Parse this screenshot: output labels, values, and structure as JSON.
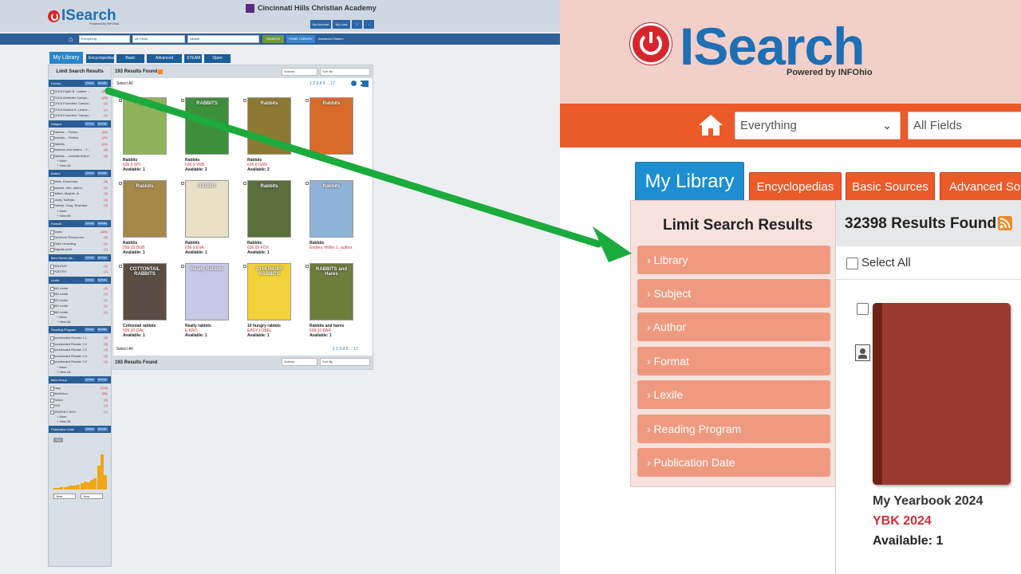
{
  "left": {
    "logo_text": "ISearch",
    "powered": "Powered by INFOhio",
    "school": "Cincinnati Hills Christian Academy",
    "header_buttons": [
      "My Account",
      "My Lists"
    ],
    "search": {
      "scope": "Everything",
      "field": "All Fields",
      "query": "rabbits",
      "search_btn": "SEARCH",
      "home_btn": "HOME LIBRARY",
      "advanced": "Advanced Search"
    },
    "tabs": [
      "My Library",
      "Encyclopedias",
      "Basic Sources",
      "Advanced Sources",
      "STEAM",
      "Open Access"
    ],
    "sidebar_title": "Limit Search Results",
    "facet_buttons": [
      "Include",
      "Exclude"
    ],
    "more": "+ More",
    "view_all": "+ View All",
    "facets": [
      {
        "title": "Library",
        "rows": [
          {
            "label": "CHCA Edyth B. Lindner ...",
            "count": "(93)"
          },
          {
            "label": "CHCA Armleder Campu...",
            "count": "(28)"
          },
          {
            "label": "CHCA Founders' Campu...",
            "count": "(1)"
          },
          {
            "label": "CHCA Martha S. Lindne...",
            "count": "(1)"
          },
          {
            "label": "CHCA Founders' Campu...",
            "count": "(1)"
          }
        ],
        "more": false
      },
      {
        "title": "Subject",
        "rows": [
          {
            "label": "Rabbits -- Fiction.",
            "count": "(44)"
          },
          {
            "label": "Animals -- Fiction.",
            "count": "(21)"
          },
          {
            "label": "Rabbits.",
            "count": "(21)"
          },
          {
            "label": "Brothers and sisters -- F...",
            "count": "(8)"
          },
          {
            "label": "Rabbits -- Juvenile fiction",
            "count": "(8)"
          }
        ],
        "more": true
      },
      {
        "title": "Author",
        "rows": [
          {
            "label": "Wells, Rosemary.",
            "count": "(8)"
          },
          {
            "label": "Bassett, Kim, author.",
            "count": "(5)"
          },
          {
            "label": "Holbet, Mayble, ill.",
            "count": "(3)"
          },
          {
            "label": "Lacey, Kathryn.",
            "count": "(3)"
          },
          {
            "label": "Potoski, Greg, illustrator.",
            "count": "(3)"
          }
        ],
        "more": true
      },
      {
        "title": "Format",
        "rows": [
          {
            "label": "Books",
            "count": "(185)"
          },
          {
            "label": "Electronic Resources",
            "count": "(5)"
          },
          {
            "label": "Video recording",
            "count": "(2)"
          },
          {
            "label": "Regular print",
            "count": "(1)"
          }
        ],
        "more": false
      },
      {
        "title": "Item Genre (Ite...",
        "rows": [
          {
            "label": "HOLIDAY",
            "count": "(1)"
          },
          {
            "label": "POETRY",
            "count": "(1)"
          }
        ],
        "more": false
      },
      {
        "title": "Lexile",
        "rows": [
          {
            "label": "340 Lexile",
            "count": "(2)"
          },
          {
            "label": "280 Lexile",
            "count": "(1)"
          },
          {
            "label": "300 Lexile",
            "count": "(1)"
          },
          {
            "label": "350 Lexile",
            "count": "(1)"
          },
          {
            "label": "380 Lexile",
            "count": "(1)"
          }
        ],
        "more": true
      },
      {
        "title": "Reading Program",
        "rows": [
          {
            "label": "Accelerated Reader 1.1",
            "count": "(3)"
          },
          {
            "label": "Accelerated Reader 2.0",
            "count": "(3)"
          },
          {
            "label": "Accelerated Reader 2.2",
            "count": "(3)"
          },
          {
            "label": "Accelerated Reader 2.3",
            "count": "(3)"
          },
          {
            "label": "Accelerated Reader 2.5",
            "count": "(3)"
          }
        ],
        "more": true
      },
      {
        "title": "Item Group",
        "rows": [
          {
            "label": "Easy",
            "count": "(133)"
          },
          {
            "label": "Nonfiction",
            "count": "(55)"
          },
          {
            "label": "Fiction",
            "count": "(9)"
          },
          {
            "label": "DVD",
            "count": "(2)"
          },
          {
            "label": "GRAPHIC NOV",
            "count": "(1)"
          }
        ],
        "more": true
      },
      {
        "title": "Publication Date",
        "rows": [],
        "more": false
      }
    ],
    "year_from": "Year",
    "year_to": "Year",
    "date_btn": "Go",
    "results_found": "193 Results Found",
    "actions": "Actions:",
    "sort": "Sort By",
    "select_all": "Select All",
    "pagination": "1 2 3 4 5 ... 17",
    "books": [
      {
        "title": "Rabbits",
        "call": "636.9 SPI",
        "avail": "Available: 1",
        "color": "#8fb35a",
        "label": "Rabbits"
      },
      {
        "title": "Rabbits",
        "call": "636.9 VRB",
        "avail": "Available: 2",
        "color": "#3e8f3b",
        "label": "RABBITS"
      },
      {
        "title": "Rabbits",
        "call": "636.9 GAN",
        "avail": "Available: 2",
        "color": "#8c7a33",
        "label": "Rabbits"
      },
      {
        "title": "",
        "call": "",
        "avail": "",
        "color": "#d86b2a",
        "label": "Rabbits"
      },
      {
        "title": "Rabbits",
        "call": "599.32 DOB",
        "avail": "Available: 1",
        "color": "#a5884c",
        "label": "Rabbits"
      },
      {
        "title": "Rabbits",
        "call": "636.9 EVA",
        "avail": "Available: 1",
        "color": "#e9e0c8",
        "label": "RABBIT"
      },
      {
        "title": "Rabbits",
        "call": "636.93 FOX",
        "avail": "Available: 1",
        "color": "#5a6f3c",
        "label": "Rabbits"
      },
      {
        "title": "Rabbits",
        "call": "Endres, Hollie J., author.",
        "avail": "",
        "color": "#8fb2d8",
        "label": "Rabbits"
      },
      {
        "title": "Cottontail rabbits",
        "call": "599.32 GAL",
        "avail": "Available: 1",
        "color": "#5a4e44",
        "label": "COTTONTAIL RABBITS"
      },
      {
        "title": "Really rabbits",
        "call": "E KRO",
        "avail": "Available: 1",
        "color": "#c8c8e8",
        "label": "Really Rabbits"
      },
      {
        "title": "10 hungry rabbits",
        "call": "EASY LOBEL",
        "avail": "Available: 1",
        "color": "#f2d23a",
        "label": "10 HUNGRY RABBITS"
      },
      {
        "title": "Rabbits and hares",
        "call": "599.32 BAR",
        "avail": "Available: 1",
        "color": "#6d7d3a",
        "label": "RABBITS and Hares"
      }
    ]
  },
  "right": {
    "logo_text": "ISearch",
    "powered": "Powered by INFOhio",
    "scope": "Everything",
    "field": "All Fields",
    "tabs": [
      "My Library",
      "Encyclopedias",
      "Basic Sources",
      "Advanced Sou"
    ],
    "sidebar_title": "Limit Search Results",
    "facets": [
      "› Library",
      "› Subject",
      "› Author",
      "› Format",
      "› Lexile",
      "› Reading Program",
      "› Publication Date"
    ],
    "results_found": "32398 Results Found",
    "select_all": "Select All",
    "book": {
      "title": "My Yearbook 2024",
      "call": "YBK 2024",
      "avail": "Available: 1"
    }
  },
  "colors": {
    "arrow": "#1aab3c",
    "orange": "#ec5a29",
    "blue": "#1d8ed0",
    "brand_blue": "#1f6fb4",
    "red": "#d7262b"
  }
}
